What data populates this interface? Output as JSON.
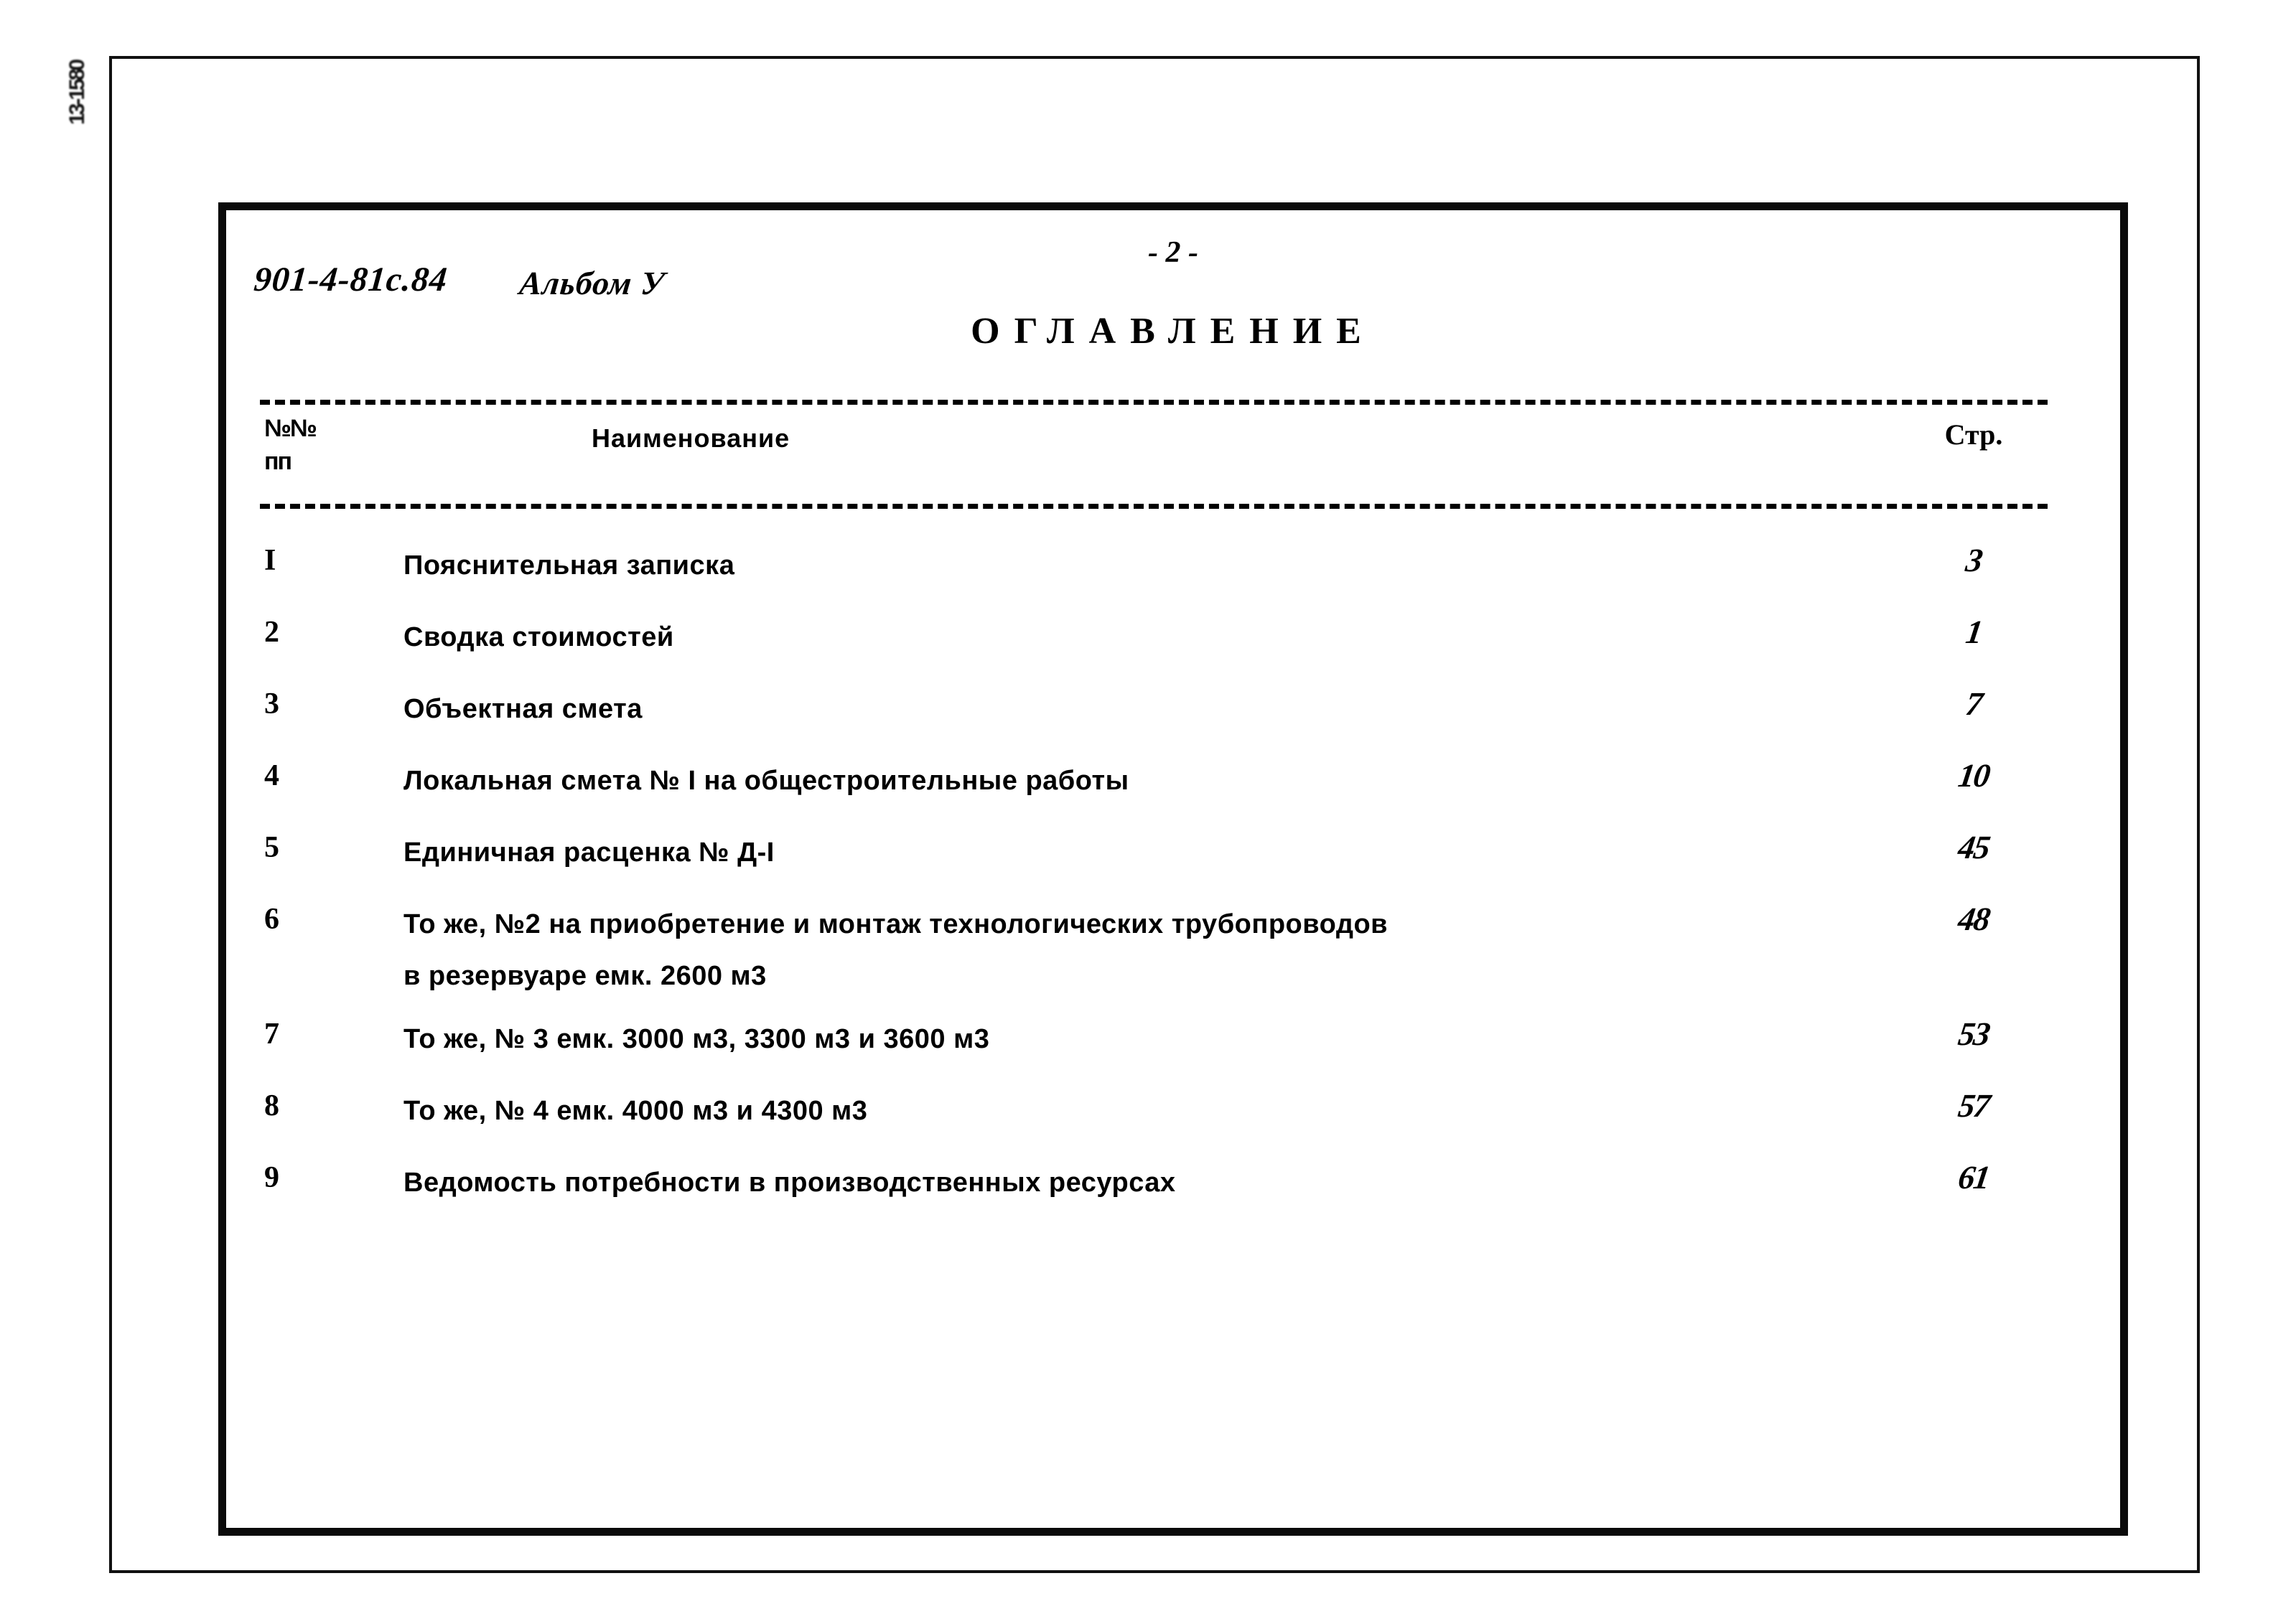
{
  "margin_stamp": "13-1580",
  "header": {
    "doc_code": "901-4-81с.84",
    "album": "Альбом У",
    "page_marker": "- 2 -",
    "title": "ОГЛАВЛЕНИЕ"
  },
  "table": {
    "columns": {
      "num_line1": "№№",
      "num_line2": "пп",
      "name": "Наименование",
      "page": "Стр."
    },
    "rows": [
      {
        "num": "I",
        "name": "Пояснительная записка",
        "name2": "",
        "page": "3"
      },
      {
        "num": "2",
        "name": "Сводка стоимостей",
        "name2": "",
        "page": "1"
      },
      {
        "num": "3",
        "name": "Объектная смета",
        "name2": "",
        "page": "7"
      },
      {
        "num": "4",
        "name": "Локальная смета № I на общестроительные работы",
        "name2": "",
        "page": "10"
      },
      {
        "num": "5",
        "name": "Единичная расценка № Д-I",
        "name2": "",
        "page": "45"
      },
      {
        "num": "6",
        "name": "То же, №2 на приобретение и монтаж технологических трубопроводов",
        "name2": "в резервуаре емк. 2600 м3",
        "page": "48"
      },
      {
        "num": "7",
        "name": "То же, № 3 емк. 3000 м3, 3300 м3 и 3600 м3",
        "name2": "",
        "page": "53"
      },
      {
        "num": "8",
        "name": "То же, № 4 емк. 4000 м3 и 4300 м3",
        "name2": "",
        "page": "57"
      },
      {
        "num": "9",
        "name": "Ведомость потребности в производственных ресурсах",
        "name2": "",
        "page": "61"
      }
    ]
  }
}
